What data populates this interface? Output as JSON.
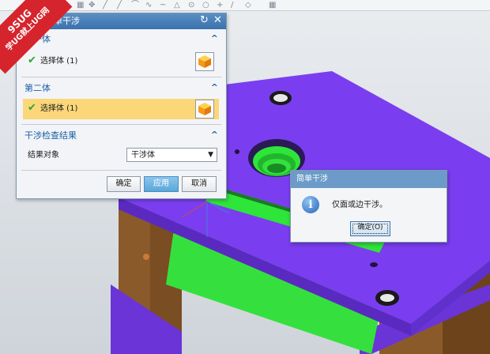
{
  "window": {
    "toolbar_icons": [
      "snap-icon",
      "line-icon",
      "arc-icon",
      "point-icon",
      "curve-icon",
      "circle-icon",
      "plus-icon",
      "grid-icon"
    ]
  },
  "watermark": {
    "line1": "9SUG",
    "line2": "学UG就上UG网"
  },
  "dialog": {
    "title": "简单干涉",
    "group1": {
      "label": "第一体",
      "selection": "选择体 (1)"
    },
    "group2": {
      "label": "第二体",
      "selection": "选择体 (1)"
    },
    "group3": {
      "label": "干涉检查结果",
      "field_label": "结果对象",
      "field_value": "干涉体"
    },
    "buttons": {
      "ok": "确定",
      "apply": "应用",
      "cancel": "取消"
    }
  },
  "message_box": {
    "title": "简单干涉",
    "text": "仅面或边干涉。",
    "ok": "确定(O)"
  },
  "colors": {
    "part_body": "#7a3ef0",
    "side_walls": "#8a5a2b",
    "interference": "#2ee53a",
    "accent": "#3b72ad"
  }
}
